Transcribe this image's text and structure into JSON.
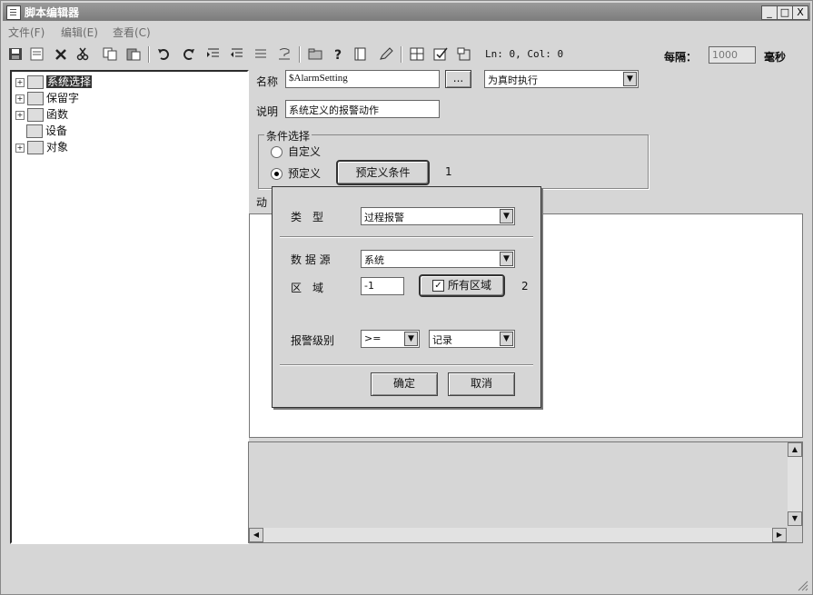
{
  "window": {
    "title": "脚本编辑器",
    "min": "_",
    "max": "□",
    "close": "X"
  },
  "menu": [
    "文件(F)",
    "编辑(E)",
    "查看(C)"
  ],
  "toolbar": {
    "cursor_status": "Ln: 0, Col: 0",
    "interval_label": "每隔：",
    "interval_value": "1000",
    "interval_unit": "毫秒"
  },
  "tree": {
    "items": [
      {
        "label": "系统选择",
        "expander": "+",
        "icon": "folder-icon",
        "selected": true
      },
      {
        "label": "保留字",
        "expander": "+",
        "icon": "folder-icon"
      },
      {
        "label": "函数",
        "expander": "+",
        "icon": "function-icon"
      },
      {
        "label": "设备",
        "expander": "",
        "icon": "device-icon"
      },
      {
        "label": "对象",
        "expander": "+",
        "icon": "object-icon"
      }
    ]
  },
  "form": {
    "name_label": "名称",
    "name_value": "$AlarmSetting",
    "browse_label": "...",
    "exec_mode": "为真时执行",
    "desc_label": "说明",
    "desc_value": "系统定义的报警动作",
    "condition_group": "条件选择",
    "radio_custom": "自定义",
    "radio_predefined": "预定义",
    "predef_button": "预定义条件",
    "callout_1": "1",
    "action_label_partial": "动"
  },
  "dialog": {
    "type_label": "类　型",
    "type_value": "过程报警",
    "source_label": "数 据 源",
    "source_value": "系统",
    "area_label": "区　域",
    "area_value": "-1",
    "all_areas_label": "所有区域",
    "all_areas_checked": "✓",
    "callout_2": "2",
    "level_label": "报警级别",
    "level_op": ">=",
    "level_value": "记录",
    "ok_label": "确定",
    "cancel_label": "取消"
  },
  "colors": {
    "titlebar": "#888888",
    "window_bg": "#d6d6d6",
    "panel_bg": "#ffffff"
  }
}
